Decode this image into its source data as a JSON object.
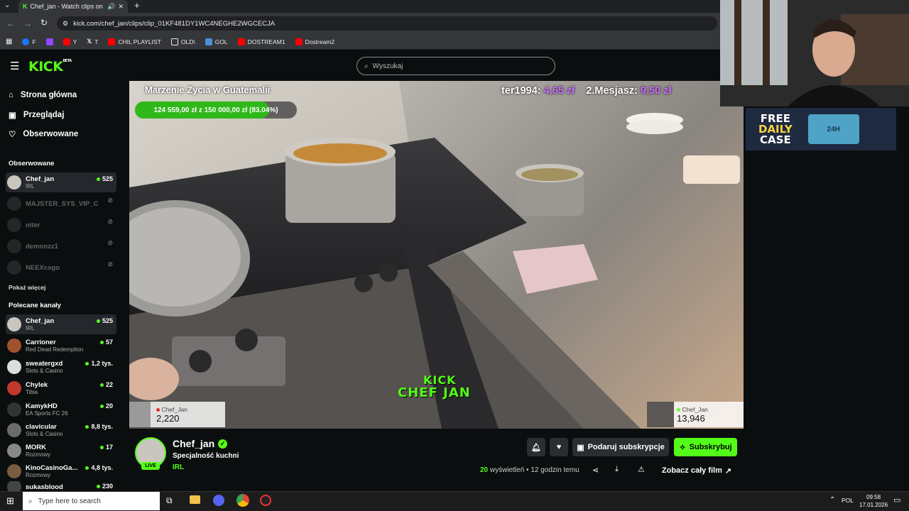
{
  "browser": {
    "tab_title": "Chef_jan - Watch clips on K",
    "url": "kick.com/chef_jan/clips/clip_01KF481DY1WC4NEGHE2WGCECJA",
    "bookmarks": [
      {
        "label": "F",
        "color": "#1877f2"
      },
      {
        "label": "",
        "color": "#9146ff"
      },
      {
        "label": "Y",
        "color": "#ff0000"
      },
      {
        "label": "T",
        "color": "#cccccc"
      },
      {
        "label": "CHIL PLAYLIST",
        "color": "#ff0000"
      },
      {
        "label": "OLD\\",
        "color": "#e8eaed"
      },
      {
        "label": "GOL",
        "color": "#4a90d9"
      },
      {
        "label": "DOSTREAM1",
        "color": "#ff0000"
      },
      {
        "label": "Dostream2",
        "color": "#ff0000"
      }
    ]
  },
  "kick": {
    "logo": "KICK",
    "logo_badge": "BETA",
    "search_placeholder": "Wyszukaj",
    "accent": "#53fc18"
  },
  "sidebar": {
    "nav": [
      {
        "label": "Strona główna",
        "icon": "home-icon"
      },
      {
        "label": "Przeglądaj",
        "icon": "browse-icon"
      },
      {
        "label": "Obserwowane",
        "icon": "heart-icon"
      }
    ],
    "followed_heading": "Obserwowane",
    "followed": [
      {
        "name": "Chef_jan",
        "sub": "IRL",
        "viewers": "525",
        "live": true
      },
      {
        "name": "MAJSTER_SYS_VIP_C",
        "sub": "",
        "viewers": "",
        "live": false
      },
      {
        "name": "niter",
        "sub": "",
        "viewers": "",
        "live": false
      },
      {
        "name": "demonzz1",
        "sub": "",
        "viewers": "",
        "live": false
      },
      {
        "name": "NEEXcsgo",
        "sub": "",
        "viewers": "",
        "live": false
      }
    ],
    "show_more": "Pokaż więcej",
    "recommended_heading": "Polecane kanały",
    "recommended": [
      {
        "name": "Chef_jan",
        "sub": "IRL",
        "viewers": "525"
      },
      {
        "name": "Carrioner",
        "sub": "Red Dead Redemption",
        "viewers": "57"
      },
      {
        "name": "sweatergxd",
        "sub": "Slots & Casino",
        "viewers": "1,2 tys."
      },
      {
        "name": "Chylek",
        "sub": "Tibia",
        "viewers": "22"
      },
      {
        "name": "KamykHD",
        "sub": "EA Sports FC 26",
        "viewers": "20"
      },
      {
        "name": "clavicular",
        "sub": "Slots & Casino",
        "viewers": "8,8 tys."
      },
      {
        "name": "MORK",
        "sub": "Rozmowy",
        "viewers": "17"
      },
      {
        "name": "KinoCasinoGa...",
        "sub": "Rozmowy",
        "viewers": "4,8 tys."
      },
      {
        "name": "sukasblood",
        "sub": "",
        "viewers": "230"
      }
    ]
  },
  "video": {
    "goal_title": "Marzenie Zycia w Guatemalii",
    "goal_text": "124 559,00 zł z 150 000,00 zł (83.04%)",
    "goal_fraction": 0.8304,
    "ticker": [
      {
        "name": "ter1994:",
        "amount": "4,65 zł"
      },
      {
        "name": "2.Mesjasz:",
        "amount": "9,50 zł"
      }
    ],
    "watermark_1": "KICK",
    "watermark_2": "CHEF JAN",
    "sub_left_name": "Chef_Jan",
    "sub_left_count": "2,220",
    "sub_right_name": "Chef_Jan",
    "sub_right_count": "13,946"
  },
  "overlay": {
    "free_case": [
      "FREE",
      "DAILY",
      "CASE"
    ],
    "case_label": "24H"
  },
  "channel": {
    "name": "Chef_jan",
    "title": "Specjalność kuchni",
    "category": "IRL",
    "live_badge": "LIVE",
    "views_count": "20",
    "views_label": "wyświetleń",
    "time_ago": "12 godzin temu",
    "gift_label": "Podaruj subskrypcje",
    "subscribe_label": "Subskrybuj",
    "full_video_label": "Zobacz cały film"
  },
  "taskbar": {
    "search_placeholder": "Type here to search",
    "lang": "POL",
    "time": "09:58",
    "date": "17.01.2026"
  }
}
